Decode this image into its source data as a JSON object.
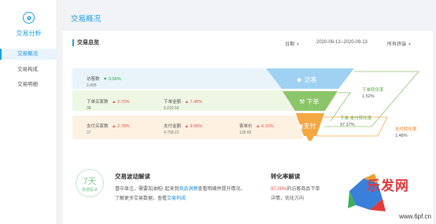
{
  "sidebar": {
    "brand_title": "交易分析",
    "items": [
      {
        "label": "交易概况",
        "active": true
      },
      {
        "label": "交易构成"
      },
      {
        "label": "交易明细"
      }
    ]
  },
  "page_title": "交易概况",
  "overview": {
    "title": "交易总览",
    "filter_date_label": "日期",
    "date_range": "2020-09-13~2020-09-13",
    "terminal_label": "所有终端"
  },
  "metrics": {
    "visitors": {
      "label": "访客数",
      "change": "0.56%",
      "value": "2,495"
    },
    "order_buyers": {
      "label": "下单买家数",
      "change": "2.70%",
      "value": "38"
    },
    "order_amount": {
      "label": "下单金额",
      "change": "7.45%",
      "value": "5,010.50"
    },
    "pay_buyers": {
      "label": "支付买家数",
      "change": "2.78%",
      "value": "37"
    },
    "pay_amount": {
      "label": "支付金额",
      "change": "9.05%",
      "value": "4,758.22"
    },
    "unit_price": {
      "label": "客单价",
      "change": "6.10%",
      "value": "128.60"
    }
  },
  "funnel": {
    "stage1": "访客",
    "stage2": "下单",
    "stage3": "支付",
    "colors": {
      "stage1": "#9fd2f2",
      "stage2": "#8cc569",
      "stage3": "#f5a742"
    }
  },
  "rates": {
    "order_rate": {
      "label": "下单转化率",
      "value": "1.52%"
    },
    "order_pay_rate": {
      "label": "下单-支付转化率",
      "value": "97.37%"
    },
    "pay_rate": {
      "label": "支付转化率",
      "value": "1.48%"
    }
  },
  "insights": {
    "badge_num": "7天",
    "badge_text": "数据解读",
    "trend": {
      "title": "交易波动解读",
      "line1_a": "喜中显注，需要加油啦! 起来到",
      "line1_link": "商品洞察",
      "line1_b": "查看明细并提升情况。",
      "line2_a": "了解更多交易数据，",
      "line2_b": "查看",
      "line2_link": "交易构成"
    },
    "conversion": {
      "title": "转化率解读",
      "line1_hl": "97.09%",
      "line1_b": "的访客商品下单",
      "line2": "详情，优化方向"
    }
  },
  "watermark": "www.6pf.cn",
  "brand_text": "乐发网"
}
